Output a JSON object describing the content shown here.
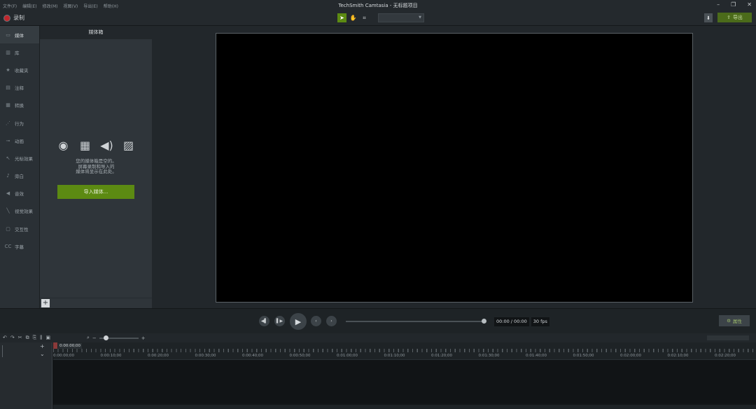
{
  "app": {
    "title": "TechSmith Camtasia - 无标题项目",
    "menu": [
      "文件(F)",
      "编辑(E)",
      "修改(M)",
      "视图(V)",
      "导出(E)",
      "帮助(H)"
    ],
    "window_controls": [
      "–",
      "❐",
      "✕"
    ]
  },
  "toolbar": {
    "record_label": "录制",
    "zoom_value": "",
    "export_label": "导出"
  },
  "nav": {
    "items": [
      {
        "label": "媒体",
        "icon": "media-icon",
        "glyph": "▭"
      },
      {
        "label": "库",
        "icon": "library-icon",
        "glyph": "▥"
      },
      {
        "label": "收藏夹",
        "icon": "favorites-icon",
        "glyph": "★"
      },
      {
        "label": "注释",
        "icon": "annotation-icon",
        "glyph": "▤"
      },
      {
        "label": "转换",
        "icon": "transition-icon",
        "glyph": "▦"
      },
      {
        "label": "行为",
        "icon": "behavior-icon",
        "glyph": "⋰"
      },
      {
        "label": "动画",
        "icon": "animation-icon",
        "glyph": "⊸"
      },
      {
        "label": "光标效果",
        "icon": "cursor-effects-icon",
        "glyph": "↖"
      },
      {
        "label": "旁白",
        "icon": "narration-icon",
        "glyph": "🎙"
      },
      {
        "label": "音效",
        "icon": "audio-effects-icon",
        "glyph": "◀"
      },
      {
        "label": "视觉效果",
        "icon": "visual-effects-icon",
        "glyph": "╲"
      },
      {
        "label": "交互性",
        "icon": "interactivity-icon",
        "glyph": "▢"
      },
      {
        "label": "字幕",
        "icon": "captions-icon",
        "glyph": "CC"
      }
    ],
    "active_index": 0
  },
  "media_bin": {
    "title": "媒体箱",
    "empty_line1": "您的媒体箱是空的。",
    "empty_line2": "屏幕录制和导入的",
    "empty_line3": "媒体将显示在此处。",
    "import_label": "导入媒体...",
    "add_label": "+"
  },
  "playback": {
    "time": "00:00 / 00:00",
    "fps": "30 fps",
    "properties_label": "属性"
  },
  "timeline": {
    "playhead_time": "0:00:00;00",
    "ruler_labels": [
      "0:00:00;00",
      "0:00:10;00",
      "0:00:20;00",
      "0:00:30;00",
      "0:00:40;00",
      "0:00:50;00",
      "0:01:00;00",
      "0:01:10;00",
      "0:01:20;00",
      "0:01:30;00",
      "0:01:40;00",
      "0:01:50;00",
      "0:02:00;00",
      "0:02:10;00",
      "0:02:20;00"
    ]
  },
  "colors": {
    "accent": "#5c8a12",
    "record": "#c1272d"
  }
}
